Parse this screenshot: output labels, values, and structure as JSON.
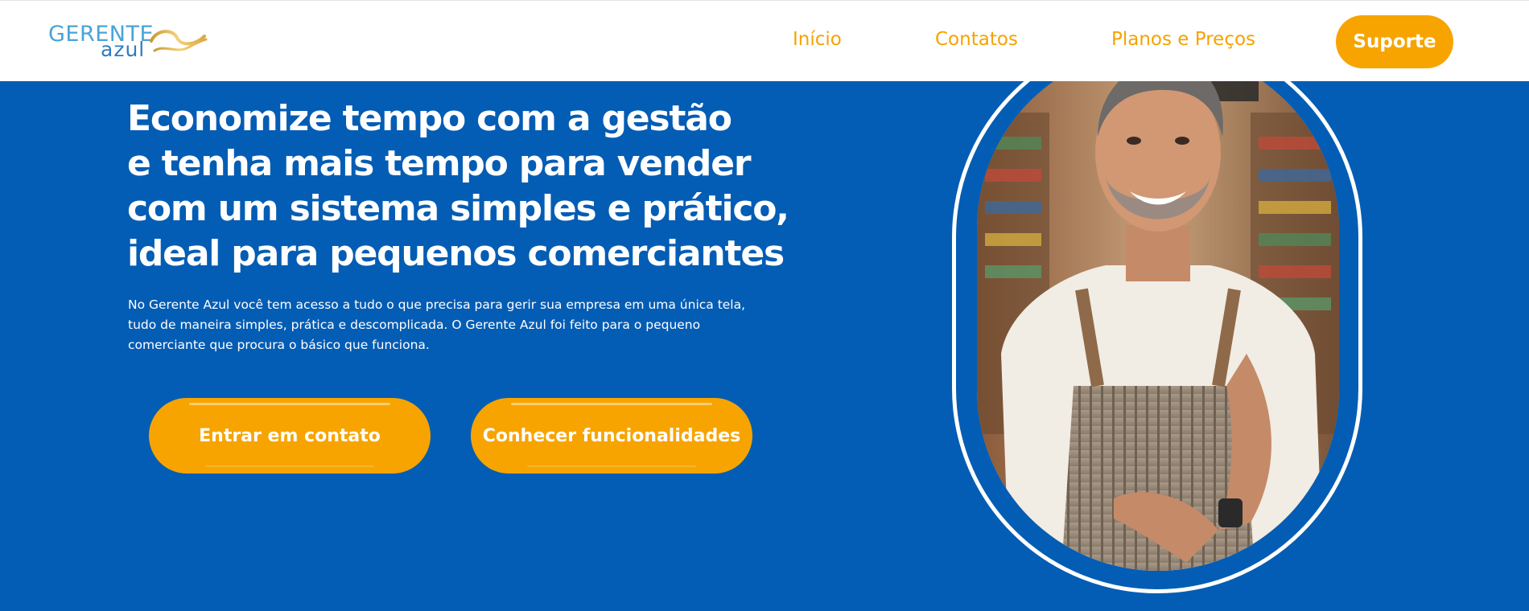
{
  "brand": {
    "logo_top": "GERENTE",
    "logo_bottom": "azul"
  },
  "nav": {
    "items": [
      "Início",
      "Contatos",
      "Planos e Preços"
    ],
    "support_label": "Suporte"
  },
  "hero": {
    "title_lines": [
      "Economize tempo com a gestão",
      "e tenha mais tempo para vender",
      "com um sistema simples e prático,",
      "ideal para pequenos comerciantes"
    ],
    "description_lines": [
      "No Gerente Azul você tem acesso a tudo o que precisa para gerir sua empresa em uma única tela,",
      "tudo de maneira simples, prática e descomplicada. O Gerente Azul foi feito para o pequeno",
      "comerciante que procura o básico que funciona."
    ],
    "buttons": {
      "contact": "Entrar em contato",
      "features": "Conhecer funcionalidades"
    }
  },
  "colors": {
    "primary_blue": "#045db4",
    "accent_orange": "#f7a400",
    "nav_text": "#f5a300",
    "white": "#ffffff"
  },
  "icons": {
    "logo_swoosh": "logo-swoosh-icon"
  }
}
